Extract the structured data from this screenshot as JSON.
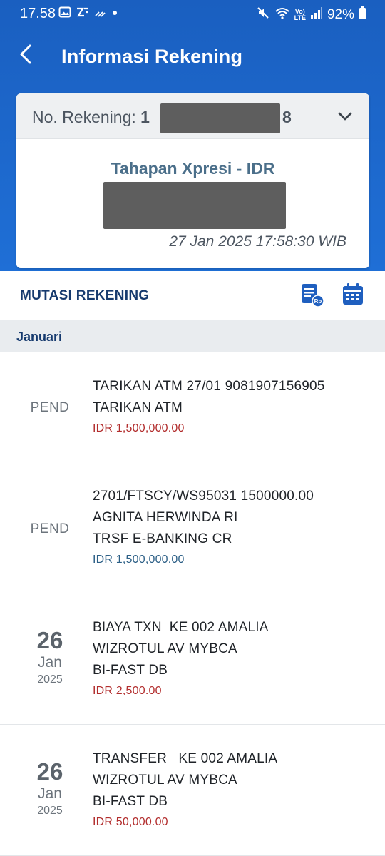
{
  "status_bar": {
    "time": "17.58",
    "battery": "92%",
    "network": "LTE"
  },
  "header": {
    "title": "Informasi Rekening"
  },
  "account": {
    "label": "No. Rekening:",
    "number_prefix": "1",
    "number_suffix": "8",
    "product": "Tahapan Xpresi - IDR",
    "timestamp": "27 Jan 2025 17:58:30 WIB"
  },
  "mutasi": {
    "title": "MUTASI REKENING"
  },
  "month": "Januari",
  "transactions": [
    {
      "status": "PEND",
      "lines": [
        "TARIKAN ATM 27/01 9081907156905",
        "TARIKAN ATM"
      ],
      "amount": "IDR 1,500,000.00",
      "type": "debit"
    },
    {
      "status": "PEND",
      "lines": [
        "2701/FTSCY/WS95031 1500000.00",
        "AGNITA HERWINDA RI",
        "TRSF E-BANKING CR"
      ],
      "amount": "IDR 1,500,000.00",
      "type": "credit"
    },
    {
      "day": "26",
      "month": "Jan",
      "year": "2025",
      "lines": [
        "BIAYA TXN  KE 002 AMALIA",
        "WIZROTUL AV MYBCA",
        "BI-FAST DB"
      ],
      "amount": "IDR 2,500.00",
      "type": "debit"
    },
    {
      "day": "26",
      "month": "Jan",
      "year": "2025",
      "lines": [
        "TRANSFER   KE 002 AMALIA",
        "WIZROTUL AV MYBCA",
        "BI-FAST DB"
      ],
      "amount": "IDR 50,000.00",
      "type": "debit"
    }
  ],
  "colors": {
    "header_blue": "#1f6fd6",
    "debit_red": "#b22d2d",
    "credit_blue": "#2c5f86",
    "navy": "#163a6e"
  }
}
